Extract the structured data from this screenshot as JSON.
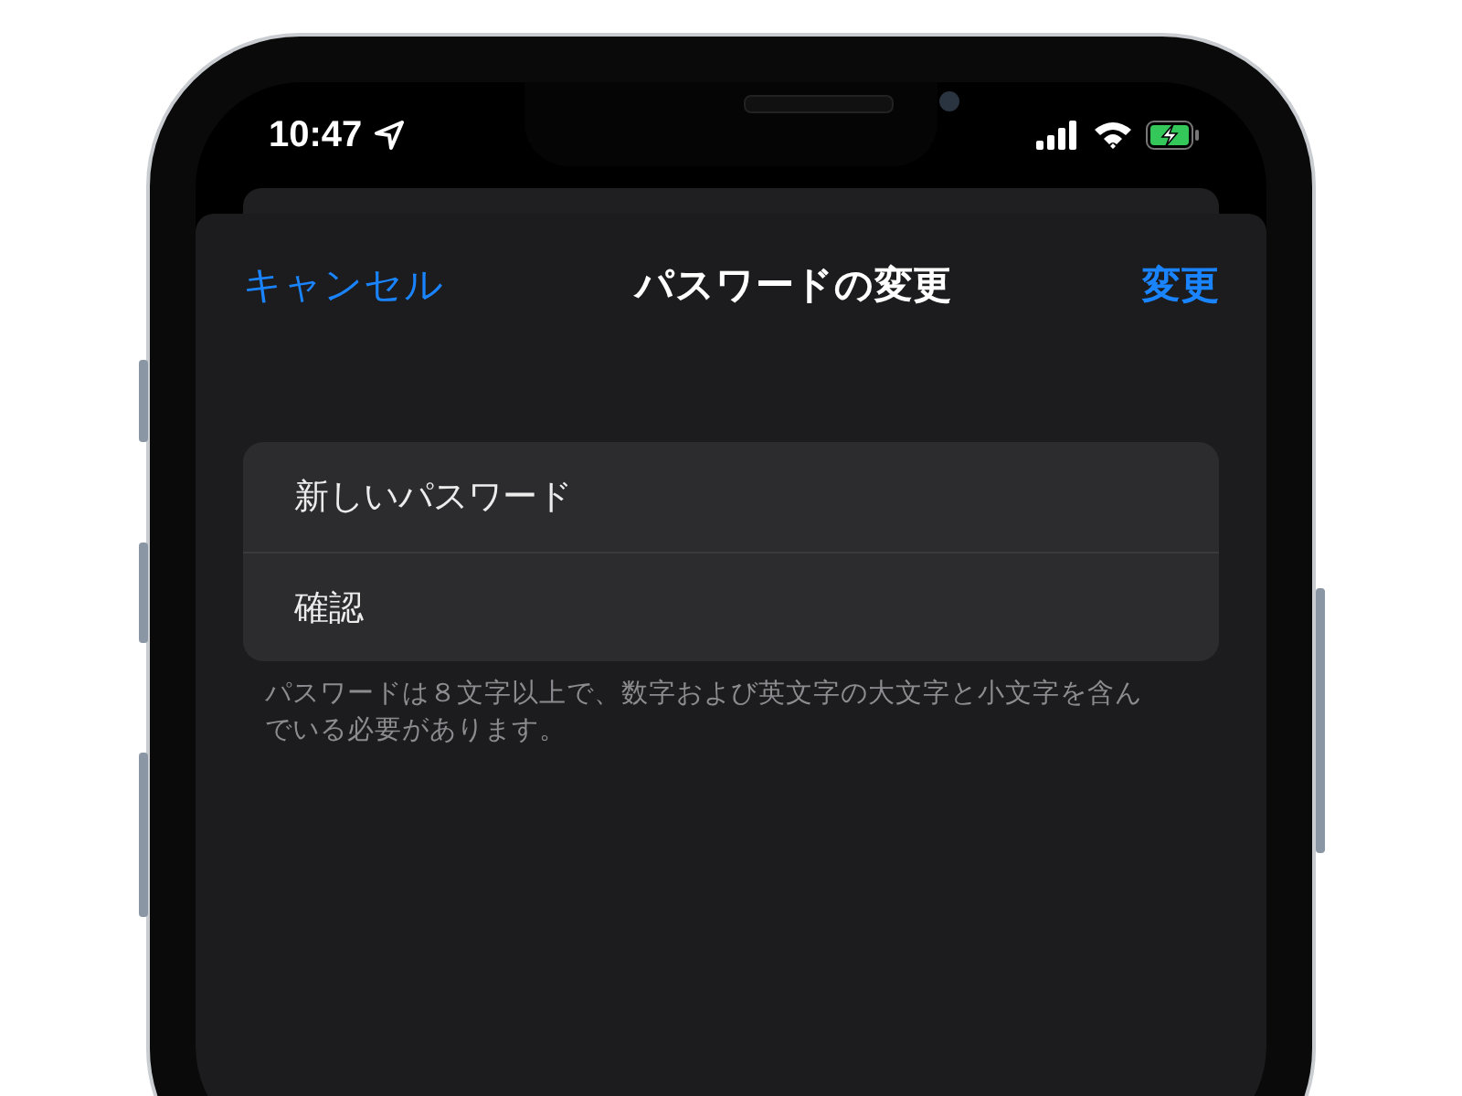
{
  "status_bar": {
    "time": "10:47"
  },
  "nav": {
    "cancel": "キャンセル",
    "title": "パスワードの変更",
    "confirm": "変更"
  },
  "fields": [
    {
      "placeholder": "新しいパスワード"
    },
    {
      "placeholder": "確認"
    }
  ],
  "footer": "パスワードは８文字以上で、数字および英文字の大文字と小文字を含んでいる必要があります。"
}
